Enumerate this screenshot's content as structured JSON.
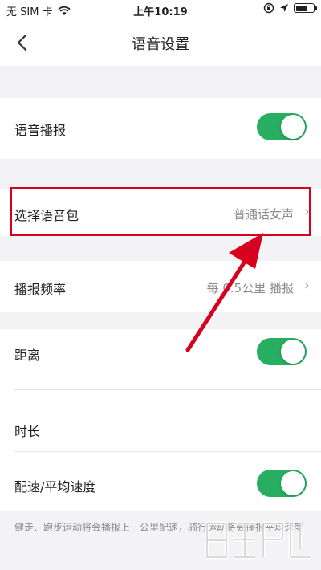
{
  "status_bar": {
    "carrier": "无 SIM 卡",
    "time": "上午10:19",
    "battery_level": 0.7
  },
  "nav": {
    "title": "语音设置",
    "back_icon": "chevron-left-icon"
  },
  "settings": {
    "voice_broadcast": {
      "label": "语音播报",
      "enabled": true
    },
    "voice_package": {
      "label": "选择语音包",
      "value": "普通话女声"
    },
    "broadcast_frequency": {
      "label": "播报频率",
      "value": "每 0.5公里 播报"
    },
    "distance": {
      "label": "距离",
      "enabled": true
    },
    "duration": {
      "label": "时长"
    },
    "pace": {
      "label": "配速/平均速度",
      "enabled": true
    }
  },
  "footer_note": "健走、跑步运动将会播报上一公里配速，骑行运动将会播报平均速度",
  "annotation": {
    "highlight_color": "#d8001f",
    "arrow_color": "#d8001f"
  },
  "colors": {
    "toggle_on": "#27ae60",
    "background": "#f3f3f5"
  }
}
